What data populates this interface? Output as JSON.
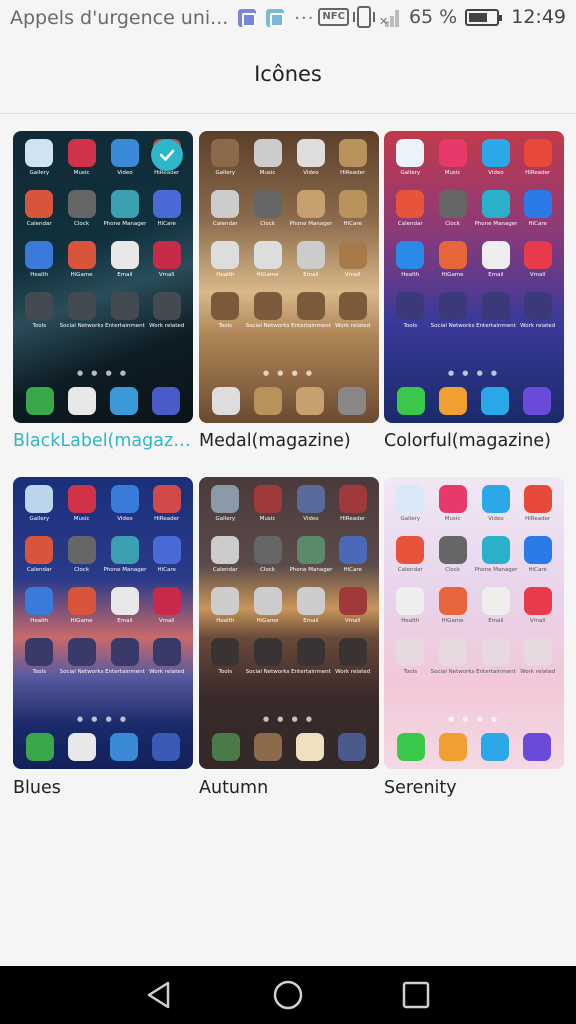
{
  "status_bar": {
    "title": "Appels d'urgence uni...",
    "dots": "···",
    "nfc": "NFC",
    "battery_pct": "65 %",
    "battery_level": 0.65,
    "time": "12:49"
  },
  "header": {
    "title": "Icônes"
  },
  "themes": [
    {
      "name": "BlackLabel(magazi...",
      "selected": true,
      "apps": [
        "Gallery",
        "Music",
        "Video",
        "HiReader",
        "Calendar",
        "Clock",
        "Phone Manager",
        "HiCare",
        "Health",
        "HiGame",
        "Email",
        "Vmall",
        "Tools",
        "Social Networks",
        "Entertainment",
        "Work related"
      ]
    },
    {
      "name": "Medal(magazine)",
      "selected": false,
      "apps": [
        "Gallery",
        "Music",
        "Video",
        "HiReader",
        "Calendar",
        "Clock",
        "Phone Manager",
        "HiCare",
        "Health",
        "HiGame",
        "Email",
        "Vmall",
        "Tools",
        "Social Networks",
        "Entertainment",
        "Work related"
      ]
    },
    {
      "name": "Colorful(magazine)",
      "selected": false,
      "apps": [
        "Gallery",
        "Music",
        "Video",
        "HiReader",
        "Calendar",
        "Clock",
        "Phone Manager",
        "HiCare",
        "Health",
        "HiGame",
        "Email",
        "Vmall",
        "Tools",
        "Social Networks",
        "Entertainment",
        "Work related"
      ]
    },
    {
      "name": "Blues",
      "selected": false,
      "apps": [
        "Gallery",
        "Music",
        "Video",
        "HiReader",
        "Calendar",
        "Clock",
        "Phone Manager",
        "HiCare",
        "Health",
        "HiGame",
        "Email",
        "Vmall",
        "Tools",
        "Social Networks",
        "Entertainment",
        "Work related"
      ]
    },
    {
      "name": "Autumn",
      "selected": false,
      "apps": [
        "Gallery",
        "Music",
        "Video",
        "HiReader",
        "Calendar",
        "Clock",
        "Phone Manager",
        "HiCare",
        "Health",
        "HiGame",
        "Email",
        "Vmall",
        "Tools",
        "Social Networks",
        "Entertainment",
        "Work related"
      ]
    },
    {
      "name": "Serenity",
      "selected": false,
      "apps": [
        "Gallery",
        "Music",
        "Video",
        "HiReader",
        "Calendar",
        "Clock",
        "Phone Manager",
        "HiCare",
        "Health",
        "HiGame",
        "Email",
        "Vmall",
        "Tools",
        "Social Networks",
        "Entertainment",
        "Work related"
      ]
    }
  ],
  "colors": {
    "accent": "#2eb7c9",
    "background": "#f5f5f5",
    "nav_bar": "#000000"
  },
  "nav": {
    "back": "back-icon",
    "home": "home-icon",
    "recents": "recents-icon"
  }
}
